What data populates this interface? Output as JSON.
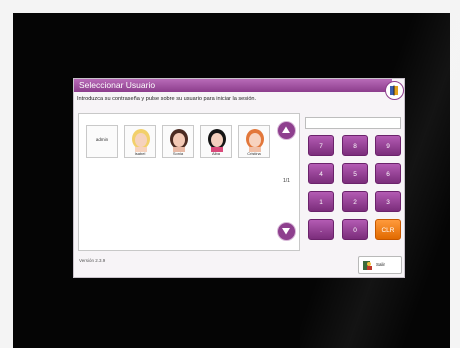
{
  "window": {
    "title": "Seleccionar Usuario",
    "instructions": "Introduzca su contraseña y pulse sobre su usuario para iniciar la sesión."
  },
  "users": [
    {
      "name": "admin",
      "avatar": "none"
    },
    {
      "name": "Isabel",
      "avatar": "blonde-woman-icon"
    },
    {
      "name": "Sonia",
      "avatar": "brunette-woman-icon"
    },
    {
      "name": "Alba",
      "avatar": "dark-hair-woman-icon"
    },
    {
      "name": "Cristina",
      "avatar": "redhead-woman-icon"
    }
  ],
  "pager": {
    "indicator": "1/1"
  },
  "keypad": {
    "keys": [
      "7",
      "8",
      "9",
      "4",
      "5",
      "6",
      "1",
      "2",
      "3",
      ".",
      "0",
      "CLR"
    ]
  },
  "footer": {
    "version": "Versión 2.3.9",
    "exit_label": "Salir"
  },
  "colors": {
    "accent": "#8c3d8c",
    "clear_key": "#f08520",
    "screen_bg": "#050505"
  }
}
